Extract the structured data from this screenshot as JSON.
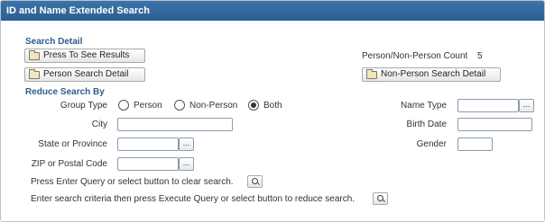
{
  "panel": {
    "title": "ID and Name Extended Search"
  },
  "search_detail": {
    "heading": "Search Detail",
    "results_button": "Press To See Results",
    "person_button": "Person Search Detail",
    "count_label": "Person/Non-Person Count",
    "count_value": "5",
    "non_person_button": "Non-Person Search Detail"
  },
  "reduce": {
    "heading": "Reduce Search By",
    "group_type_label": "Group Type",
    "options": [
      {
        "label": "Person",
        "selected": false
      },
      {
        "label": "Non-Person",
        "selected": false
      },
      {
        "label": "Both",
        "selected": true
      }
    ],
    "city_label": "City",
    "state_label": "State or Province",
    "zip_label": "ZIP or Postal Code",
    "name_type_label": "Name Type",
    "birth_date_label": "Birth Date",
    "gender_label": "Gender",
    "ellipsis": "..."
  },
  "instructions": {
    "clear": "Press Enter Query or select button to clear search.",
    "reduce": "Enter search criteria then press Execute Query or select button to reduce search."
  }
}
